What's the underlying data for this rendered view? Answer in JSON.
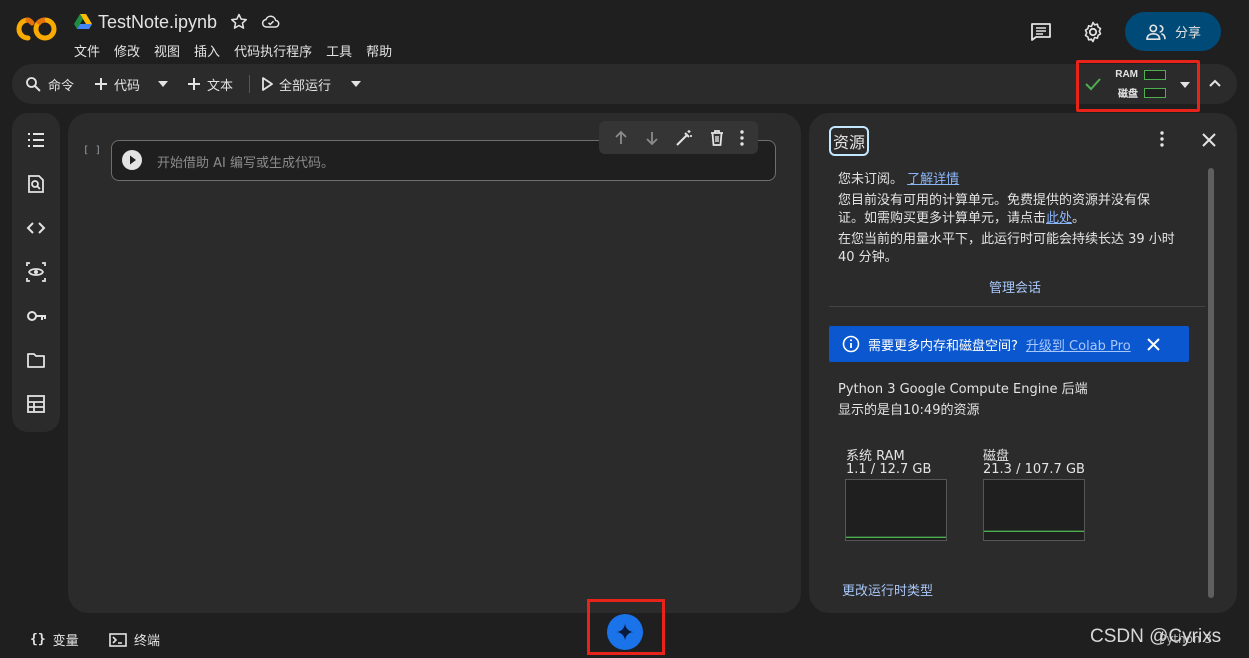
{
  "header": {
    "file_name": "TestNote.ipynb",
    "menu": [
      "文件",
      "修改",
      "视图",
      "插入",
      "代码执行程序",
      "工具",
      "帮助"
    ],
    "share_label": "分享"
  },
  "toolbar": {
    "command_label": "命令",
    "code_label": "代码",
    "text_label": "文本",
    "run_all_label": "全部运行",
    "ram_label": "RAM",
    "disk_label": "磁盘"
  },
  "cell": {
    "bracket": "[ ]",
    "placeholder": "开始借助 AI 编写或生成代码。"
  },
  "panel": {
    "title": "资源",
    "not_subscribed": "您未订阅。",
    "learn_more": "了解详情",
    "line1": "您目前没有可用的计算单元。免费提供的资源并没有保",
    "line2_pre": "证。如需购买更多计算单元，请点击",
    "line2_link": "此处",
    "line2_post": "。",
    "line3": "在您当前的用量水平下，此运行时可能会持续长达 39 小时",
    "line4": "40 分钟。",
    "manage_sessions": "管理会话",
    "banner_text": "需要更多内存和磁盘空间?",
    "banner_link": "升级到 Colab Pro",
    "backend": "Python 3 Google Compute Engine 后端",
    "shown_since": "显示的是自10:49的资源",
    "ram": {
      "label": "系统 RAM",
      "value": "1.1 / 12.7 GB",
      "fraction": 0.087
    },
    "disk": {
      "label": "磁盘",
      "value": "21.3 / 107.7 GB",
      "fraction": 0.198
    },
    "change_runtime": "更改运行时类型"
  },
  "status": {
    "variables": "变量",
    "terminal": "终端",
    "kernel": "Python 3",
    "watermark": "CSDN @Cyrixs"
  },
  "colors": {
    "background": "#1f1f1f",
    "surface": "#2b2b2b",
    "accent_blue": "#0b57d0",
    "share_bg": "#004a77",
    "link": "#8ab4f8",
    "highlight_red": "#e8231a",
    "ok_green": "#4caf50"
  }
}
